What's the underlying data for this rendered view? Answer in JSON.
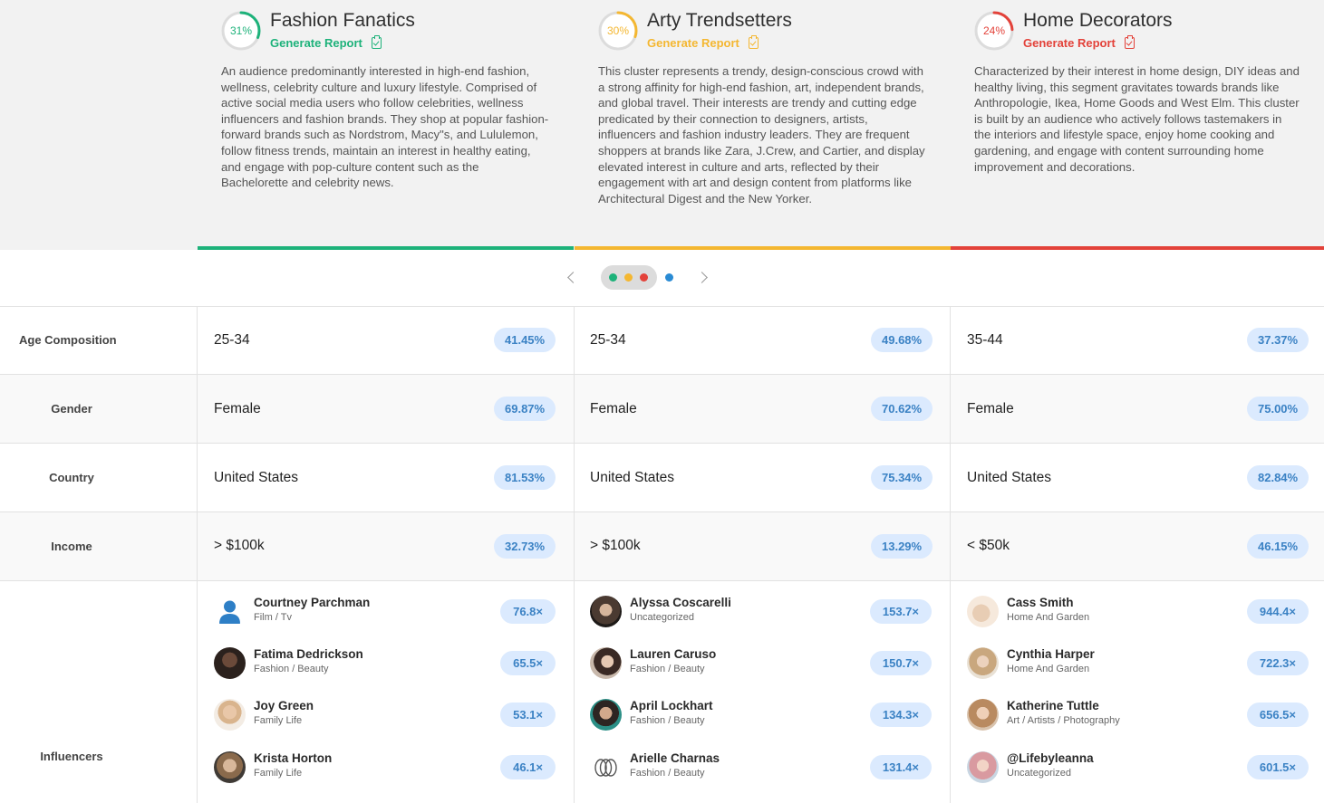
{
  "colors": {
    "green": "#1db27a",
    "yellow": "#f4b731",
    "red": "#e3423a",
    "blue_dot": "#2a8bd4",
    "badge_bg": "#dbeafe",
    "badge_text": "#3b82c4"
  },
  "clusters": [
    {
      "percent": "31%",
      "percent_value": 0.31,
      "title": "Fashion Fanatics",
      "generate_label": "Generate Report",
      "generate_icon": "clipboard-check-icon",
      "color": "#1db27a",
      "description": "An audience predominantly interested in high-end fashion, wellness, celebrity culture and luxury lifestyle. Comprised of active social media users who follow celebrities, wellness influencers and fashion brands. They shop at popular fashion-forward brands such as Nordstrom, Macy\"s, and Lululemon, follow fitness trends, maintain an interest in healthy eating, and engage with pop-culture content such as the Bachelorette and celebrity news."
    },
    {
      "percent": "30%",
      "percent_value": 0.3,
      "title": "Arty Trendsetters",
      "generate_label": "Generate Report",
      "generate_icon": "clipboard-check-icon",
      "color": "#f4b731",
      "description": "This cluster represents a trendy, design-conscious crowd with a strong affinity for high-end fashion, art, independent brands, and global travel. Their interests are trendy and cutting edge predicated by their connection to designers, artists, influencers and fashion industry leaders. They are frequent shoppers at brands like Zara, J.Crew, and Cartier, and display elevated interest in culture and arts, reflected by their engagement with art and design content from platforms like Architectural Digest and the New Yorker."
    },
    {
      "percent": "24%",
      "percent_value": 0.24,
      "title": "Home Decorators",
      "generate_label": "Generate Report",
      "generate_icon": "clipboard-check-icon",
      "color": "#e3423a",
      "description": "Characterized by their interest in home design, DIY ideas and healthy living, this segment gravitates towards brands like Anthropologie, Ikea, Home Goods and West Elm. This cluster is built by an audience who actively follows tastemakers in the interiors and lifestyle space, enjoy home cooking and gardening, and engage with content surrounding home improvement and decorations."
    }
  ],
  "pager": {
    "prev_icon": "chevron-left-icon",
    "next_icon": "chevron-right-icon",
    "dots": [
      "#1db27a",
      "#f4b731",
      "#e3423a",
      "#2a8bd4"
    ]
  },
  "rows": {
    "age": {
      "label": "Age Composition",
      "cells": [
        {
          "value": "25-34",
          "pct": "41.45%"
        },
        {
          "value": "25-34",
          "pct": "49.68%"
        },
        {
          "value": "35-44",
          "pct": "37.37%"
        }
      ]
    },
    "gender": {
      "label": "Gender",
      "cells": [
        {
          "value": "Female",
          "pct": "69.87%"
        },
        {
          "value": "Female",
          "pct": "70.62%"
        },
        {
          "value": "Female",
          "pct": "75.00%"
        }
      ]
    },
    "country": {
      "label": "Country",
      "cells": [
        {
          "value": "United States",
          "pct": "81.53%"
        },
        {
          "value": "United States",
          "pct": "75.34%"
        },
        {
          "value": "United States",
          "pct": "82.84%"
        }
      ]
    },
    "income": {
      "label": "Income",
      "cells": [
        {
          "value": "> $100k",
          "pct": "32.73%"
        },
        {
          "value": "> $100k",
          "pct": "13.29%"
        },
        {
          "value": "< $50k",
          "pct": "46.15%"
        }
      ]
    },
    "influencers": {
      "label": "Influencers",
      "columns": [
        [
          {
            "name": "Courtney Parchman",
            "category": "Film / Tv",
            "score": "76.8×",
            "avatar": "default-user-icon"
          },
          {
            "name": "Fatima Dedrickson",
            "category": "Fashion / Beauty",
            "score": "65.5×",
            "avatar": "photo"
          },
          {
            "name": "Joy Green",
            "category": "Family Life",
            "score": "53.1×",
            "avatar": "photo"
          },
          {
            "name": "Krista Horton",
            "category": "Family Life",
            "score": "46.1×",
            "avatar": "photo"
          }
        ],
        [
          {
            "name": "Alyssa Coscarelli",
            "category": "Uncategorized",
            "score": "153.7×",
            "avatar": "photo"
          },
          {
            "name": "Lauren Caruso",
            "category": "Fashion / Beauty",
            "score": "150.7×",
            "avatar": "photo"
          },
          {
            "name": "April Lockhart",
            "category": "Fashion / Beauty",
            "score": "134.3×",
            "avatar": "photo"
          },
          {
            "name": "Arielle Charnas",
            "category": "Fashion / Beauty",
            "score": "131.4×",
            "avatar": "logo"
          }
        ],
        [
          {
            "name": "Cass Smith",
            "category": "Home And Garden",
            "score": "944.4×",
            "avatar": "photo"
          },
          {
            "name": "Cynthia Harper",
            "category": "Home And Garden",
            "score": "722.3×",
            "avatar": "photo"
          },
          {
            "name": "Katherine Tuttle",
            "category": "Art / Artists / Photography",
            "score": "656.5×",
            "avatar": "photo"
          },
          {
            "name": "@Lifebyleanna",
            "category": "Uncategorized",
            "score": "601.5×",
            "avatar": "photo"
          }
        ]
      ]
    }
  }
}
